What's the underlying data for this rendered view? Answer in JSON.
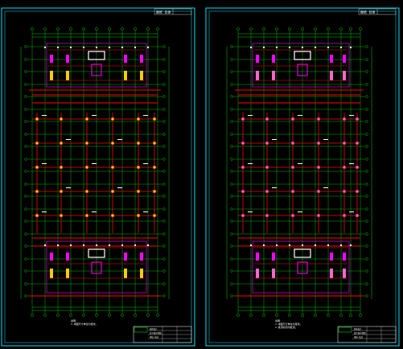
{
  "drawing": {
    "background": "#000000",
    "colors": {
      "frame": "#00e5ff",
      "axis": "#00ff00",
      "beam": "#ff0000",
      "column_left": "#ffcc00",
      "column_right": "#ff66cc",
      "wall": "#ff00ff",
      "text": "#ffffff"
    },
    "sheets": [
      {
        "name": "sheet-left",
        "title_block_header": "图纸 目录",
        "title_block_rows": [
          "结构设计",
          "柱平面布置图",
          "审核  校对"
        ],
        "note_lines": [
          "说明：",
          "1.本图尺寸单位为毫米。"
        ]
      },
      {
        "name": "sheet-right",
        "title_block_header": "图纸 目录",
        "title_block_rows": [
          "结构设计",
          "梁平面布置图",
          "审核  校对"
        ],
        "note_lines": [
          "说明：",
          "1.本图尺寸单位为毫米。",
          "2.梁顶标高同板顶。"
        ]
      }
    ]
  }
}
